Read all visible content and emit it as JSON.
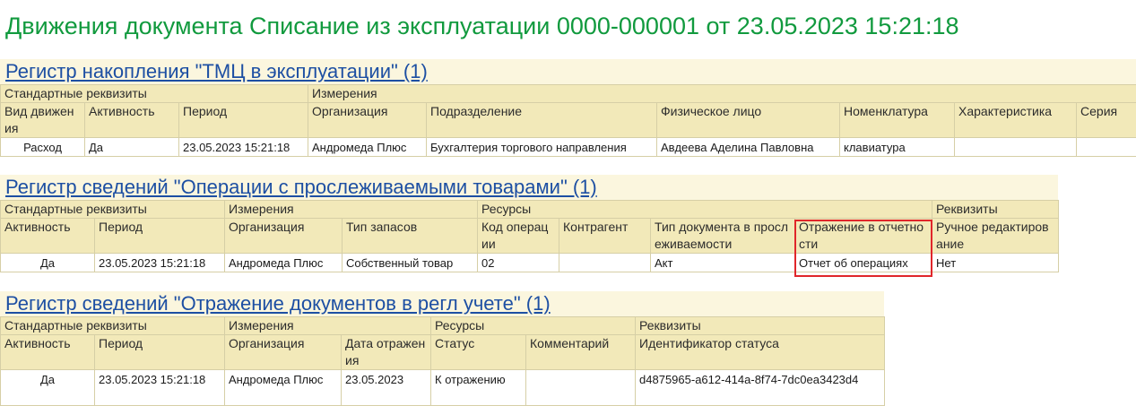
{
  "title": "Движения документа Списание из эксплуатации 0000-000001 от 23.05.2023 15:21:18",
  "colors": {
    "title": "#119a3e",
    "link": "#1d4fa3",
    "header_bg": "#f2e9b9",
    "section_bg": "#fbf6de",
    "highlight": "#e0262a",
    "expense": "#d01c1c"
  },
  "reg1": {
    "title": "Регистр накопления \"ТМЦ в эксплуатации\" (1)",
    "groups": [
      "Стандартные реквизиты",
      "Измерения"
    ],
    "columns": [
      "Вид движения",
      "Активность",
      "Период",
      "Организация",
      "Подразделение",
      "Физическое лицо",
      "Номенклатура",
      "Характеристика",
      "Серия"
    ],
    "row": [
      "Расход",
      "Да",
      "23.05.2023 15:21:18",
      "Андромеда Плюс",
      "Бухгалтерия торгового направления",
      "Авдеева Аделина Павловна",
      "клавиатура",
      "",
      ""
    ]
  },
  "reg2": {
    "title": "Регистр сведений \"Операции с прослеживаемыми товарами\" (1)",
    "groups": [
      "Стандартные реквизиты",
      "Измерения",
      "Ресурсы",
      "Реквизиты"
    ],
    "columns": [
      "Активность",
      "Период",
      "Организация",
      "Тип запасов",
      "Код операции",
      "Контрагент",
      "Тип документа в прослеживаемости",
      "Отражение в отчетности",
      "Ручное редактирование"
    ],
    "row": [
      "Да",
      "23.05.2023 15:21:18",
      "Андромеда Плюс",
      "Собственный товар",
      "02",
      "",
      "Акт",
      "Отчет об операциях",
      "Нет"
    ]
  },
  "reg3": {
    "title": "Регистр сведений \"Отражение документов в регл учете\" (1)",
    "groups": [
      "Стандартные реквизиты",
      "Измерения",
      "Ресурсы",
      "Реквизиты"
    ],
    "columns": [
      "Активность",
      "Период",
      "Организация",
      "Дата отражения",
      "Статус",
      "Комментарий",
      "Идентификатор статуса"
    ],
    "row": [
      "Да",
      "23.05.2023 15:21:18",
      "Андромеда Плюс",
      "23.05.2023",
      "К отражению",
      "",
      "d4875965-a612-414a-8f74-7dc0ea3423d4"
    ]
  }
}
